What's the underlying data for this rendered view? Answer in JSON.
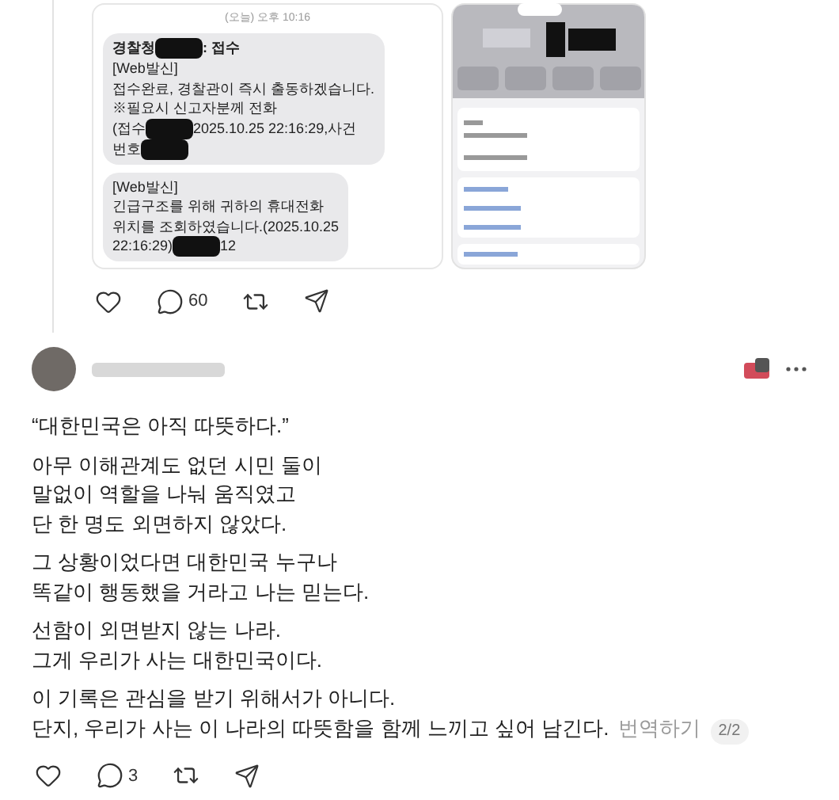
{
  "first_post": {
    "images": [
      {
        "kind": "messages",
        "timestamp": "(오늘) 오후 10:16",
        "bubbles": [
          {
            "lines": [
              {
                "bold": true,
                "parts": [
                  {
                    "kind": "text",
                    "text": "경찰청"
                  },
                  {
                    "kind": "redaction"
                  },
                  {
                    "kind": "text",
                    "text": ": 접수"
                  }
                ]
              },
              {
                "bold": false,
                "parts": [
                  {
                    "kind": "text",
                    "text": "[Web발신]"
                  }
                ]
              },
              {
                "bold": false,
                "parts": [
                  {
                    "kind": "text",
                    "text": "접수완료, 경찰관이 즉시 출동하겠습니다."
                  }
                ]
              },
              {
                "bold": false,
                "parts": [
                  {
                    "kind": "text",
                    "text": "※필요시 신고자분께 전화"
                  }
                ]
              },
              {
                "bold": false,
                "parts": [
                  {
                    "kind": "text",
                    "text": "(접수"
                  },
                  {
                    "kind": "redaction"
                  },
                  {
                    "kind": "text",
                    "text": "2025.10.25 22:16:29,사건"
                  }
                ]
              },
              {
                "bold": false,
                "parts": [
                  {
                    "kind": "text",
                    "text": "번호"
                  },
                  {
                    "kind": "redaction"
                  }
                ]
              }
            ]
          },
          {
            "lines": [
              {
                "bold": false,
                "parts": [
                  {
                    "kind": "text",
                    "text": "[Web발신]"
                  }
                ]
              },
              {
                "bold": false,
                "parts": [
                  {
                    "kind": "text",
                    "text": "긴급구조를 위해 귀하의 휴대전화"
                  }
                ]
              },
              {
                "bold": false,
                "parts": [
                  {
                    "kind": "text",
                    "text": "위치를 조회하였습니다.(2025.10.25"
                  }
                ]
              },
              {
                "bold": false,
                "parts": [
                  {
                    "kind": "text",
                    "text": "22:16:29)"
                  },
                  {
                    "kind": "redaction"
                  },
                  {
                    "kind": "text",
                    "text": "12"
                  }
                ]
              }
            ]
          }
        ]
      },
      {
        "kind": "phone"
      }
    ],
    "actions": {
      "comments": "60"
    }
  },
  "second_post": {
    "quote": "“대한민국은 아직 따뜻하다.”",
    "paragraphs": [
      [
        "아무 이해관계도 없던 시민 둘이",
        "말없이 역할을 나눠 움직였고",
        "단 한 명도 외면하지 않았다."
      ],
      [
        "그 상황이었다면 대한민국 누구나",
        "똑같이 행동했을 거라고 나는 믿는다."
      ],
      [
        "선함이 외면받지 않는 나라.",
        "그게 우리가 사는 대한민국이다."
      ],
      [
        "이 기록은 관심을 받기 위해서가 아니다.",
        "단지, 우리가 사는 이 나라의 따뜻함을 함께 느끼고 싶어 남긴다."
      ]
    ],
    "translate": "번역하기",
    "page": "2/2",
    "actions": {
      "comments": "3"
    }
  }
}
